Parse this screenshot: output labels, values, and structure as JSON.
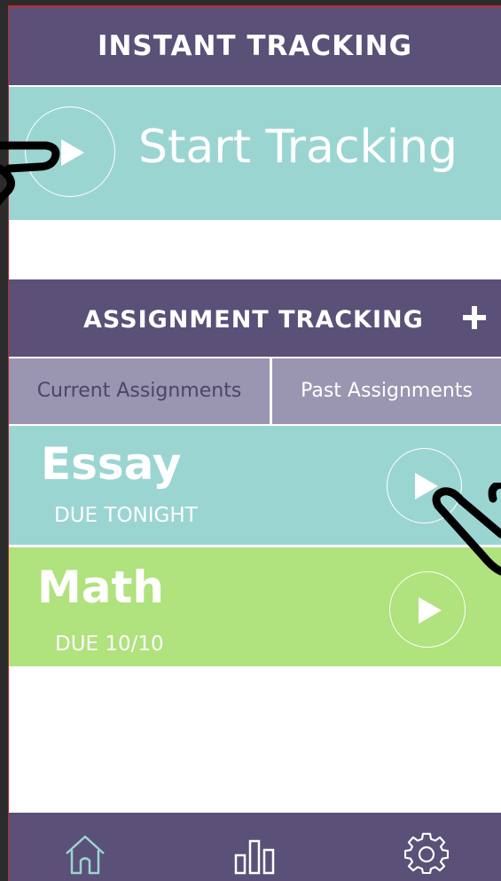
{
  "instant": {
    "header": "INSTANT TRACKING",
    "start_label": "Start Tracking"
  },
  "assignment": {
    "header": "ASSIGNMENT TRACKING",
    "tabs": [
      {
        "label": "Current Assignments",
        "selected": true
      },
      {
        "label": "Past Assignments",
        "selected": false
      }
    ],
    "items": [
      {
        "name": "Essay",
        "due": "DUE TONIGHT",
        "color": "#9bd5d1"
      },
      {
        "name": "Math",
        "due": "DUE 10/10",
        "color": "#b0e27d"
      }
    ]
  },
  "nav": {
    "items": [
      {
        "icon": "home-icon",
        "active": true
      },
      {
        "icon": "bar-chart-icon",
        "active": false
      },
      {
        "icon": "gear-icon",
        "active": false
      }
    ]
  },
  "colors": {
    "header": "#5b5077",
    "teal": "#9bd5d1",
    "green": "#b0e27d",
    "tab": "#9a95b0"
  }
}
